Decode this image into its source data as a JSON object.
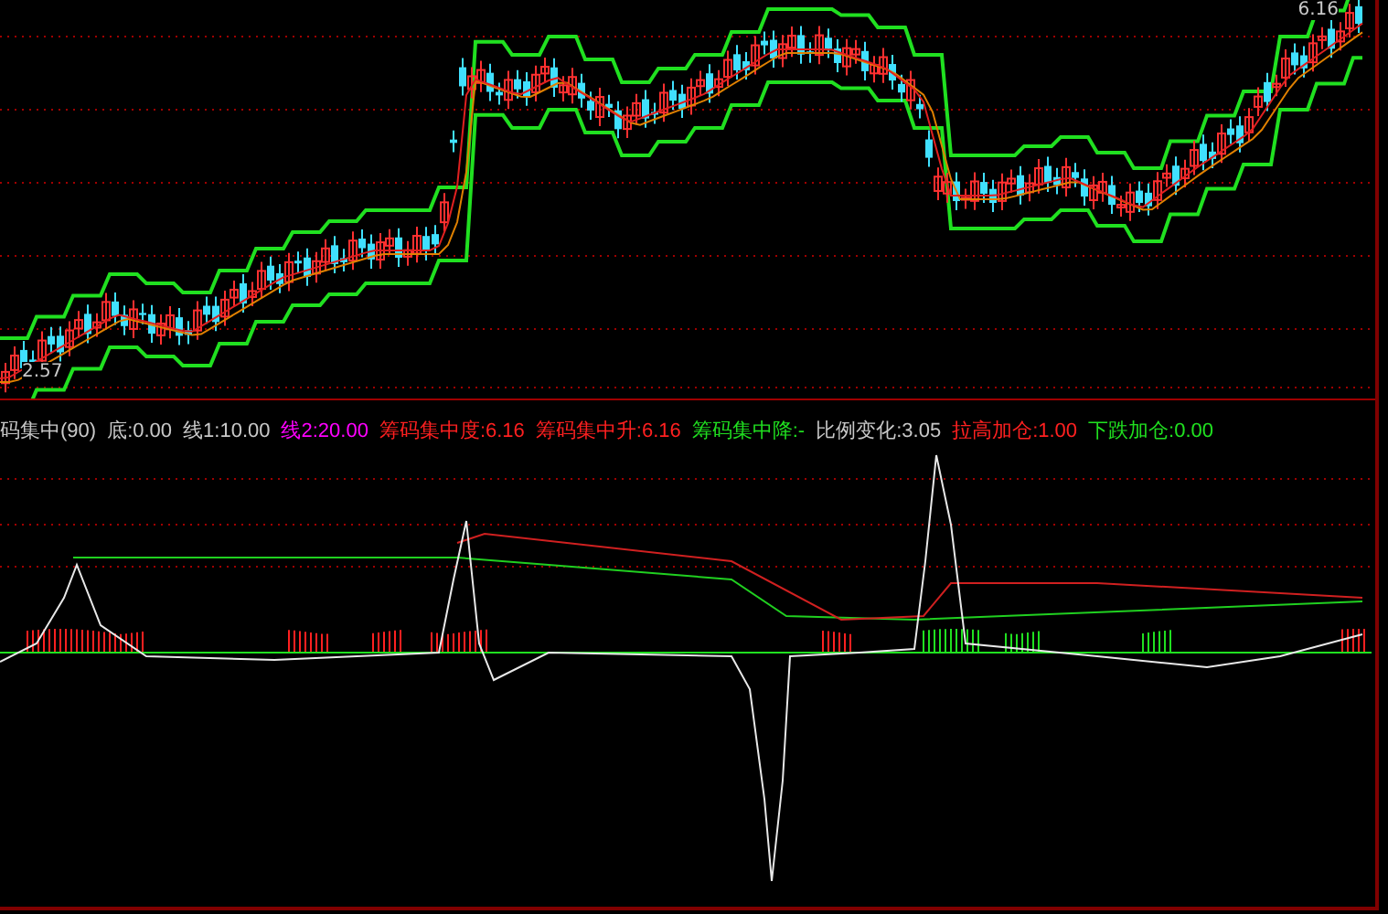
{
  "price_panel": {
    "high_label": "6.16",
    "low_label": "2.57"
  },
  "indicator_panel": {
    "title": "码集中(90)",
    "values": [
      {
        "text": "底:0.00",
        "color": "#c8c8c8"
      },
      {
        "text": "线1:10.00",
        "color": "#c8c8c8"
      },
      {
        "text": "线2:20.00",
        "color": "#ff00ff"
      },
      {
        "text": "筹码集中度:6.16",
        "color": "#ff2020"
      },
      {
        "text": "筹码集中升:6.16",
        "color": "#ff2020"
      },
      {
        "text": "筹码集中降:-",
        "color": "#20e020"
      },
      {
        "text": "比例变化:3.05",
        "color": "#c8c8c8"
      },
      {
        "text": "拉高加仓:1.00",
        "color": "#ff2020"
      },
      {
        "text": "下跌加仓:0.00",
        "color": "#20e020"
      }
    ]
  }
}
